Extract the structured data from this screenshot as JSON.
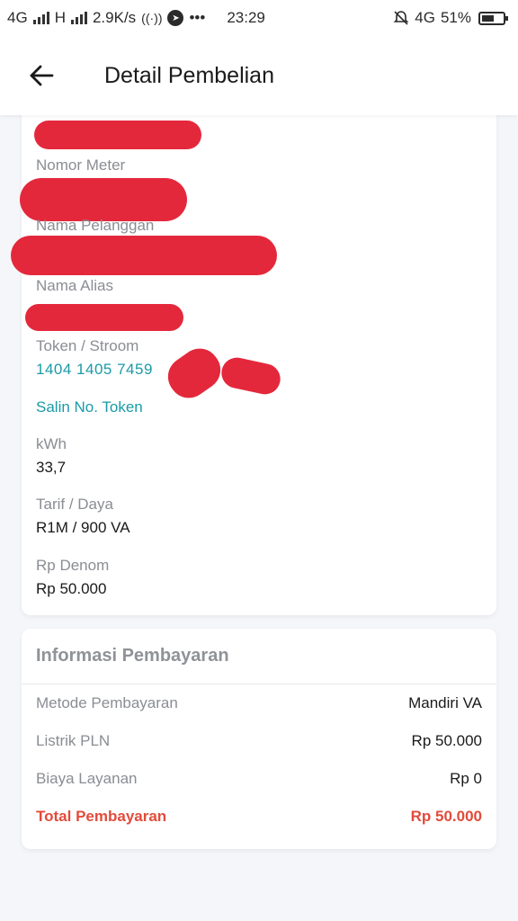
{
  "status_bar": {
    "network1": "4G",
    "network2": "H",
    "speed": "2.9K/s",
    "time": "23:29",
    "more": "•••",
    "network3": "4G",
    "battery": "51%",
    "battery_level": 51
  },
  "app_bar": {
    "title": "Detail Pembelian",
    "back_icon": "arrow-left-icon"
  },
  "detail": {
    "nomor_meter_label": "Nomor Meter",
    "nama_pelanggan_label": "Nama Pelanggan",
    "nama_alias_label": "Nama Alias",
    "token_label": "Token / Stroom",
    "token_value": "1404 1405 7459",
    "copy_token": "Salin No. Token",
    "kwh_label": "kWh",
    "kwh_value": "33,7",
    "tarif_label": "Tarif / Daya",
    "tarif_value": "R1M / 900 VA",
    "denom_label": "Rp Denom",
    "denom_value": "Rp 50.000"
  },
  "payment": {
    "title": "Informasi Pembayaran",
    "rows": [
      {
        "label": "Metode Pembayaran",
        "value": "Mandiri VA"
      },
      {
        "label": "Listrik PLN",
        "value": "Rp 50.000"
      },
      {
        "label": "Biaya Layanan",
        "value": "Rp 0"
      }
    ],
    "total_label": "Total Pembayaran",
    "total_value": "Rp 50.000"
  },
  "colors": {
    "accent_teal": "#1a9aa6",
    "total_red": "#e24b3b",
    "redaction": "#e4283c"
  }
}
